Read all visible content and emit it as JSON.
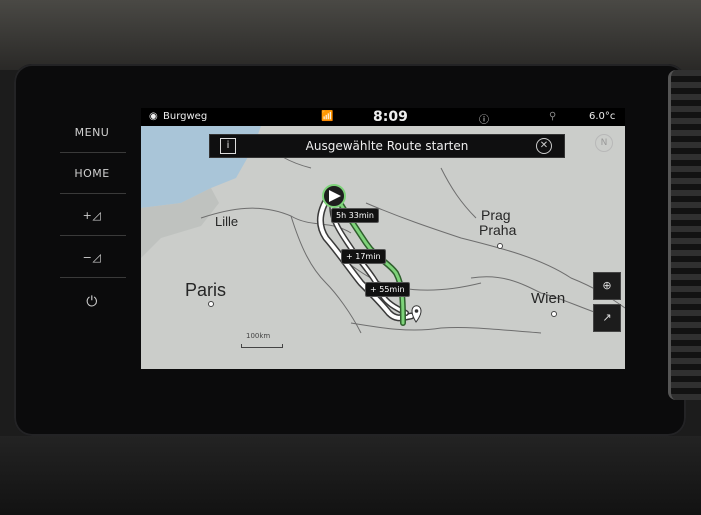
{
  "hardware_buttons": {
    "menu": "MENU",
    "home": "HOME",
    "volume_up": "+◿",
    "volume_down": "−◿",
    "power": "⏻"
  },
  "status_bar": {
    "location": "Burgweg",
    "time": "8:09",
    "temperature": "6.0°c"
  },
  "banner": {
    "info": "i",
    "text": "Ausgewählte Route starten",
    "close": "✕"
  },
  "compass": "N",
  "cities": {
    "lille": "Lille",
    "paris": "Paris",
    "prag": "Prag",
    "praha": "Praha",
    "wien": "Wien"
  },
  "routes": [
    {
      "label": "5h 33min"
    },
    {
      "label": "+ 17min"
    },
    {
      "label": "+ 55min"
    }
  ],
  "scale": "100km",
  "map_controls": {
    "view_icon": "⊕",
    "route_icon": "↗"
  },
  "colors": {
    "selected_route": "#7ed37a",
    "alt_route": "#ffffff",
    "map_bg": "#c9cbc8",
    "water": "#a9c5d8"
  }
}
